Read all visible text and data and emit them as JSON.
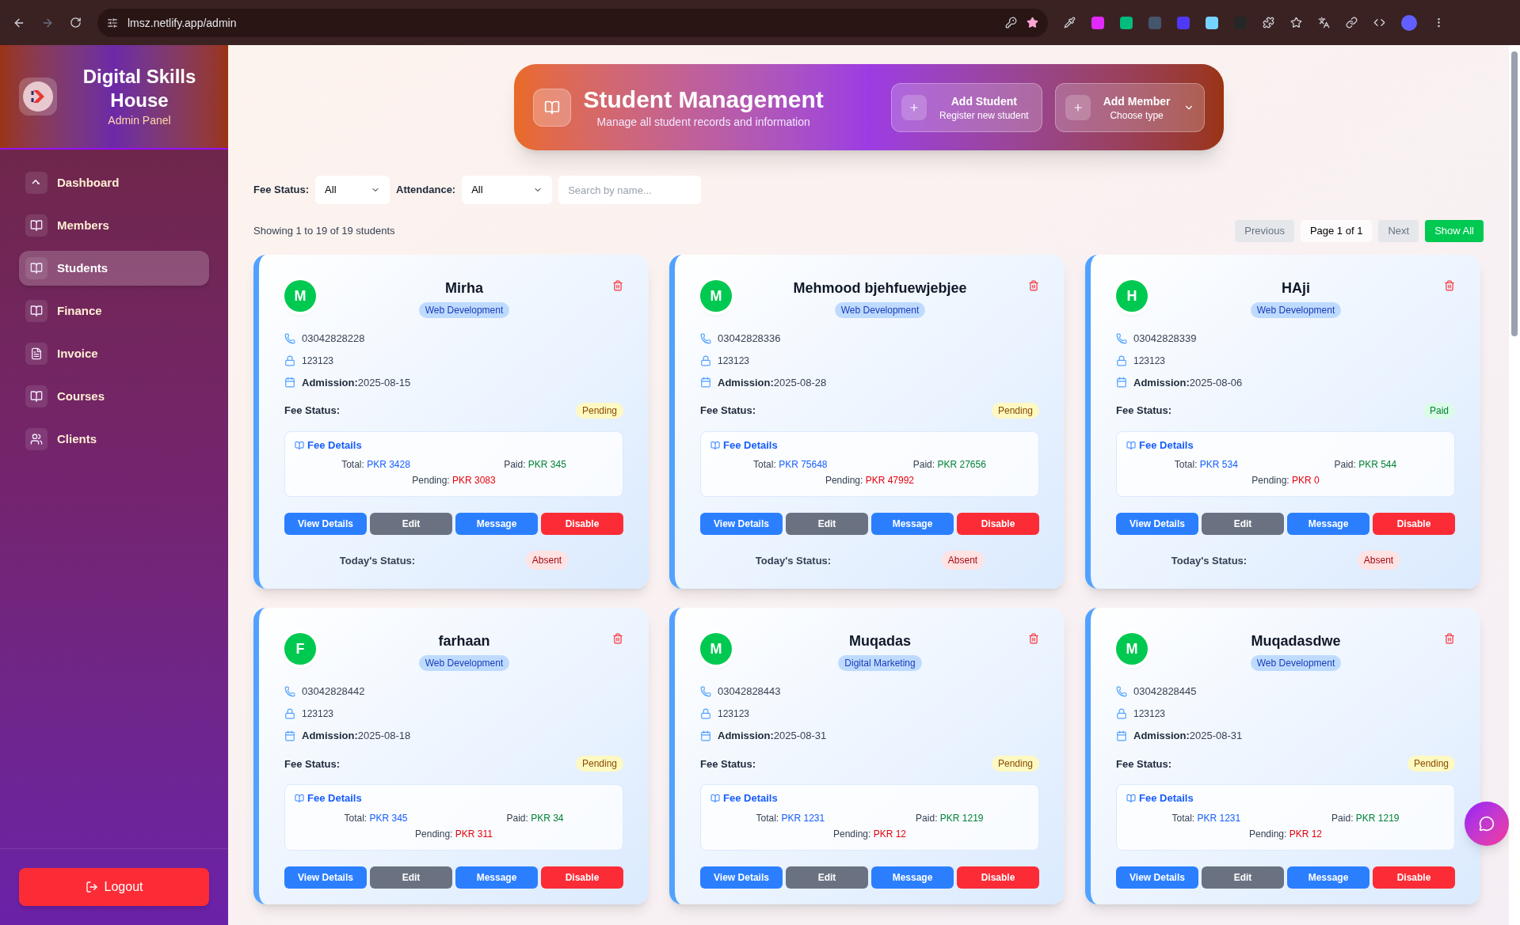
{
  "browser": {
    "url": "lmsz.netlify.app/admin"
  },
  "sidebar": {
    "brand": "Digital Skills House",
    "subtitle": "Admin Panel",
    "items": [
      {
        "label": "Dashboard",
        "kind": "dashboard",
        "selected": false
      },
      {
        "label": "Members",
        "kind": "book",
        "selected": false
      },
      {
        "label": "Students",
        "kind": "book",
        "selected": true
      },
      {
        "label": "Finance",
        "kind": "book",
        "selected": false
      },
      {
        "label": "Invoice",
        "kind": "file",
        "selected": false
      },
      {
        "label": "Courses",
        "kind": "book",
        "selected": false
      },
      {
        "label": "Clients",
        "kind": "users",
        "selected": false
      }
    ],
    "logout": "Logout"
  },
  "header": {
    "title": "Student Management",
    "subtitle": "Manage all student records and information",
    "actions": [
      {
        "title": "Add Student",
        "subtitle": "Register new student",
        "dropdown": false
      },
      {
        "title": "Add Member",
        "subtitle": "Choose type",
        "dropdown": true
      }
    ]
  },
  "filters": {
    "fee_status_label": "Fee Status:",
    "fee_status_value": "All",
    "attendance_label": "Attendance:",
    "attendance_value": "All",
    "search_placeholder": "Search by name..."
  },
  "summary": "Showing 1 to 19 of 19 students",
  "pagination": {
    "previous": "Previous",
    "page": "Page 1 of 1",
    "next": "Next",
    "show_all": "Show All",
    "previous_disabled": true,
    "next_disabled": true
  },
  "students": [
    {
      "initial": "M",
      "name": "Mirha",
      "course": "Web Development",
      "phone": "03042828228",
      "password": "123123",
      "admission_label": "Admission:",
      "admission": "2025-08-15",
      "fee_label": "Fee Status:",
      "fee_status": "Pending",
      "fee_paid": false,
      "fee_title": "Fee Details",
      "total_label": "Total:",
      "total": "PKR 3428",
      "paid_label": "Paid:",
      "paid": "PKR 345",
      "pending_label": "Pending:",
      "pending": "PKR 3083",
      "buttons": [
        "View Details",
        "Edit",
        "Message",
        "Disable"
      ],
      "today_label": "Today's Status:",
      "today": "Absent"
    },
    {
      "initial": "M",
      "name": "Mehmood bjehfuewjebjee",
      "course": "Web Development",
      "phone": "03042828336",
      "password": "123123",
      "admission_label": "Admission:",
      "admission": "2025-08-28",
      "fee_label": "Fee Status:",
      "fee_status": "Pending",
      "fee_paid": false,
      "fee_title": "Fee Details",
      "total_label": "Total:",
      "total": "PKR 75648",
      "paid_label": "Paid:",
      "paid": "PKR 27656",
      "pending_label": "Pending:",
      "pending": "PKR 47992",
      "buttons": [
        "View Details",
        "Edit",
        "Message",
        "Disable"
      ],
      "today_label": "Today's Status:",
      "today": "Absent"
    },
    {
      "initial": "H",
      "name": "HAji",
      "course": "Web Development",
      "phone": "03042828339",
      "password": "123123",
      "admission_label": "Admission:",
      "admission": "2025-08-06",
      "fee_label": "Fee Status:",
      "fee_status": "Paid",
      "fee_paid": true,
      "fee_title": "Fee Details",
      "total_label": "Total:",
      "total": "PKR 534",
      "paid_label": "Paid:",
      "paid": "PKR 544",
      "pending_label": "Pending:",
      "pending": "PKR 0",
      "buttons": [
        "View Details",
        "Edit",
        "Message",
        "Disable"
      ],
      "today_label": "Today's Status:",
      "today": "Absent"
    },
    {
      "initial": "F",
      "name": "farhaan",
      "course": "Web Development",
      "phone": "03042828442",
      "password": "123123",
      "admission_label": "Admission:",
      "admission": "2025-08-18",
      "fee_label": "Fee Status:",
      "fee_status": "Pending",
      "fee_paid": false,
      "fee_title": "Fee Details",
      "total_label": "Total:",
      "total": "PKR 345",
      "paid_label": "Paid:",
      "paid": "PKR 34",
      "pending_label": "Pending:",
      "pending": "PKR 311",
      "buttons": [
        "View Details",
        "Edit",
        "Message",
        "Disable"
      ]
    },
    {
      "initial": "M",
      "name": "Muqadas",
      "course": "Digital Marketing",
      "phone": "03042828443",
      "password": "123123",
      "admission_label": "Admission:",
      "admission": "2025-08-31",
      "fee_label": "Fee Status:",
      "fee_status": "Pending",
      "fee_paid": false,
      "fee_title": "Fee Details",
      "total_label": "Total:",
      "total": "PKR 1231",
      "paid_label": "Paid:",
      "paid": "PKR 1219",
      "pending_label": "Pending:",
      "pending": "PKR 12",
      "buttons": [
        "View Details",
        "Edit",
        "Message",
        "Disable"
      ]
    },
    {
      "initial": "M",
      "name": "Muqadasdwe",
      "course": "Web Development",
      "phone": "03042828445",
      "password": "123123",
      "admission_label": "Admission:",
      "admission": "2025-08-31",
      "fee_label": "Fee Status:",
      "fee_status": "Pending",
      "fee_paid": false,
      "fee_title": "Fee Details",
      "total_label": "Total:",
      "total": "PKR 1231",
      "paid_label": "Paid:",
      "paid": "PKR 1219",
      "pending_label": "Pending:",
      "pending": "PKR 12",
      "buttons": [
        "View Details",
        "Edit",
        "Message",
        "Disable"
      ]
    }
  ]
}
